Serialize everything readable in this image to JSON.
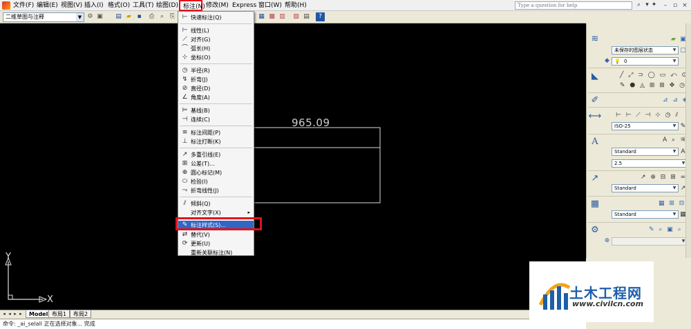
{
  "menubar": {
    "items": [
      "文件(F)",
      "编辑(E)",
      "视图(V)",
      "插入(I)",
      "格式(O)",
      "工具(T)",
      "绘图(D)",
      "标注(N)",
      "修改(M)",
      "Express",
      "窗口(W)",
      "帮助(H)"
    ],
    "help_placeholder": "Type a question for help"
  },
  "toolbar": {
    "workspace": "二维草图与注释"
  },
  "dimension_menu": {
    "items": [
      {
        "label": "快速标注(Q)",
        "icon": "quick-dim-icon",
        "glyph": "⊢"
      },
      {
        "label": "线性(L)",
        "icon": "linear-icon",
        "glyph": "⊢"
      },
      {
        "label": "对齐(G)",
        "icon": "aligned-icon",
        "glyph": "⟋"
      },
      {
        "label": "弧长(H)",
        "icon": "arc-length-icon",
        "glyph": "⌒"
      },
      {
        "label": "坐标(O)",
        "icon": "ordinate-icon",
        "glyph": "⊹"
      },
      {
        "label": "半径(R)",
        "icon": "radius-icon",
        "glyph": "◷"
      },
      {
        "label": "折弯(J)",
        "icon": "jogged-icon",
        "glyph": "↯"
      },
      {
        "label": "直径(D)",
        "icon": "diameter-icon",
        "glyph": "⊘"
      },
      {
        "label": "角度(A)",
        "icon": "angular-icon",
        "glyph": "∠"
      },
      {
        "label": "基线(B)",
        "icon": "baseline-icon",
        "glyph": "⊨"
      },
      {
        "label": "连续(C)",
        "icon": "continue-icon",
        "glyph": "⊣"
      },
      {
        "label": "标注间距(P)",
        "icon": "dim-space-icon",
        "glyph": "≡"
      },
      {
        "label": "标注打断(K)",
        "icon": "dim-break-icon",
        "glyph": "⊥"
      },
      {
        "label": "多重引线(E)",
        "icon": "multileader-icon",
        "glyph": "↗"
      },
      {
        "label": "公差(T)...",
        "icon": "tolerance-icon",
        "glyph": "⊞"
      },
      {
        "label": "圆心标记(M)",
        "icon": "center-mark-icon",
        "glyph": "⊕"
      },
      {
        "label": "检验(I)",
        "icon": "inspect-icon",
        "glyph": "⬭"
      },
      {
        "label": "折弯线性(J)",
        "icon": "jogged-linear-icon",
        "glyph": "⤳"
      },
      {
        "label": "倾斜(Q)",
        "icon": "oblique-icon",
        "glyph": "⫽"
      },
      {
        "label": "对齐文字(X)",
        "icon": "align-text-icon",
        "glyph": ""
      },
      {
        "label": "标注样式(S)...",
        "icon": "dim-style-icon",
        "glyph": "✎"
      },
      {
        "label": "替代(V)",
        "icon": "override-icon",
        "glyph": "⇄"
      },
      {
        "label": "更新(U)",
        "icon": "update-icon",
        "glyph": "⟳"
      },
      {
        "label": "重新关联标注(N)",
        "icon": "reassociate-icon",
        "glyph": ""
      }
    ]
  },
  "drawing": {
    "dimension_value": "965.09",
    "ucs_y": "Y",
    "ucs_x": "X"
  },
  "layout_tabs": [
    "Model",
    "布局1",
    "布局2"
  ],
  "command_line": "命令: _ai_selall 正在选择对象... 完成",
  "palette": {
    "layer_state": "未保存的图层状态",
    "layer": "0",
    "dim_style": "ISO-25",
    "text_style": "Standard",
    "text_height": "2.5",
    "mleader_style": "Standard",
    "table_style": "Standard"
  },
  "watermark": {
    "name": "土木工程网",
    "url": "www.civilcn.com"
  },
  "colors": {
    "menu_highlight": "#3166c2",
    "annotation_red": "#e3111b",
    "canvas": "#000000"
  }
}
